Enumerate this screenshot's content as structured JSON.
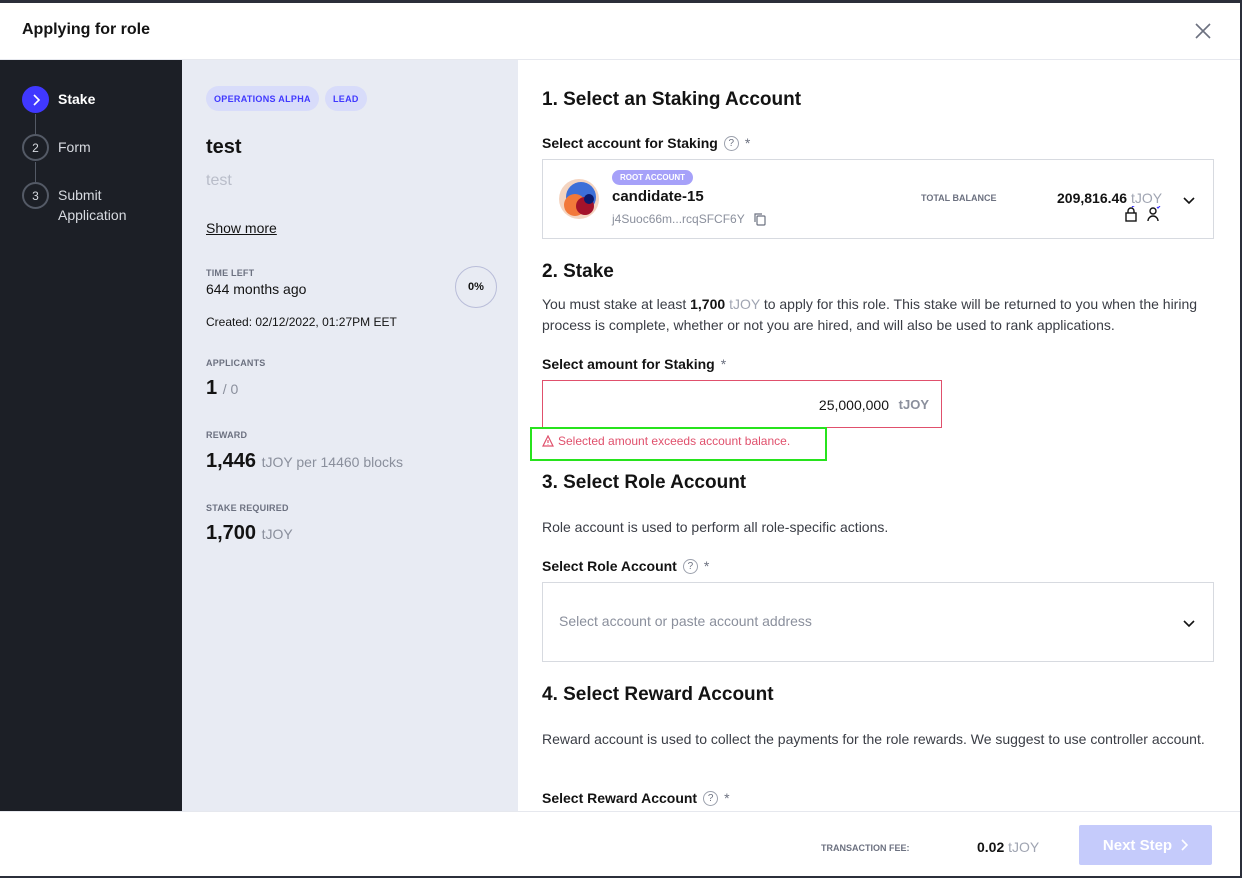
{
  "modal": {
    "title": "Applying for role"
  },
  "steps": [
    {
      "number": "",
      "label": "Stake",
      "active": true
    },
    {
      "number": "2",
      "label": "Form"
    },
    {
      "number": "3",
      "label": "Submit Application"
    }
  ],
  "role": {
    "badges": [
      "OPERATIONS ALPHA",
      "LEAD"
    ],
    "title": "test",
    "description": "test",
    "show_more": "Show more",
    "time_left_label": "TIME LEFT",
    "time_left_value": "644 months ago",
    "progress": "0%",
    "created": "Created: 02/12/2022, 01:27PM EET",
    "applicants_label": "APPLICANTS",
    "applicants_count": "1",
    "applicants_limit": "/ 0",
    "reward_label": "REWARD",
    "reward_value": "1,446",
    "reward_suffix": "tJOY per 14460 blocks",
    "stake_label": "STAKE REQUIRED",
    "stake_value": "1,700",
    "stake_unit": "tJOY"
  },
  "staking": {
    "title": "1. Select an Staking Account",
    "field_label": "Select account for Staking",
    "required": "*",
    "help": "?",
    "account": {
      "badge": "ROOT ACCOUNT",
      "name": "candidate-15",
      "address": "j4Suoc66m...rcqSFCF6Y",
      "total_label": "TOTAL BALANCE",
      "total_value": "209,816.46",
      "total_unit": "tJOY"
    }
  },
  "stake": {
    "title": "2. Stake",
    "text_before": "You must stake at least ",
    "min_amount": "1,700",
    "unit": "tJOY",
    "text_after": " to apply for this role. This stake will be returned to you when the hiring process is complete, whether or not you are hired, and will also be used to rank applications.",
    "amount_label": "Select amount for Staking",
    "amount_value": "25,000,000",
    "amount_unit": "tJOY",
    "error": "Selected amount exceeds account balance."
  },
  "role_account": {
    "title": "3. Select Role Account",
    "description": "Role account is used to perform all role-specific actions.",
    "field_label": "Select Role Account",
    "placeholder": "Select account or paste account address"
  },
  "reward_account": {
    "title": "4. Select Reward Account",
    "description": "Reward account is used to collect the payments for the role rewards. We suggest to use controller account.",
    "field_label": "Select Reward Account"
  },
  "footer": {
    "fee_label": "TRANSACTION FEE:",
    "fee_value": "0.02",
    "fee_unit": "tJOY",
    "next_label": "Next Step"
  },
  "colors": {
    "accent": "#4038ff",
    "error": "#e0506c",
    "highlight": "#27e31d"
  }
}
